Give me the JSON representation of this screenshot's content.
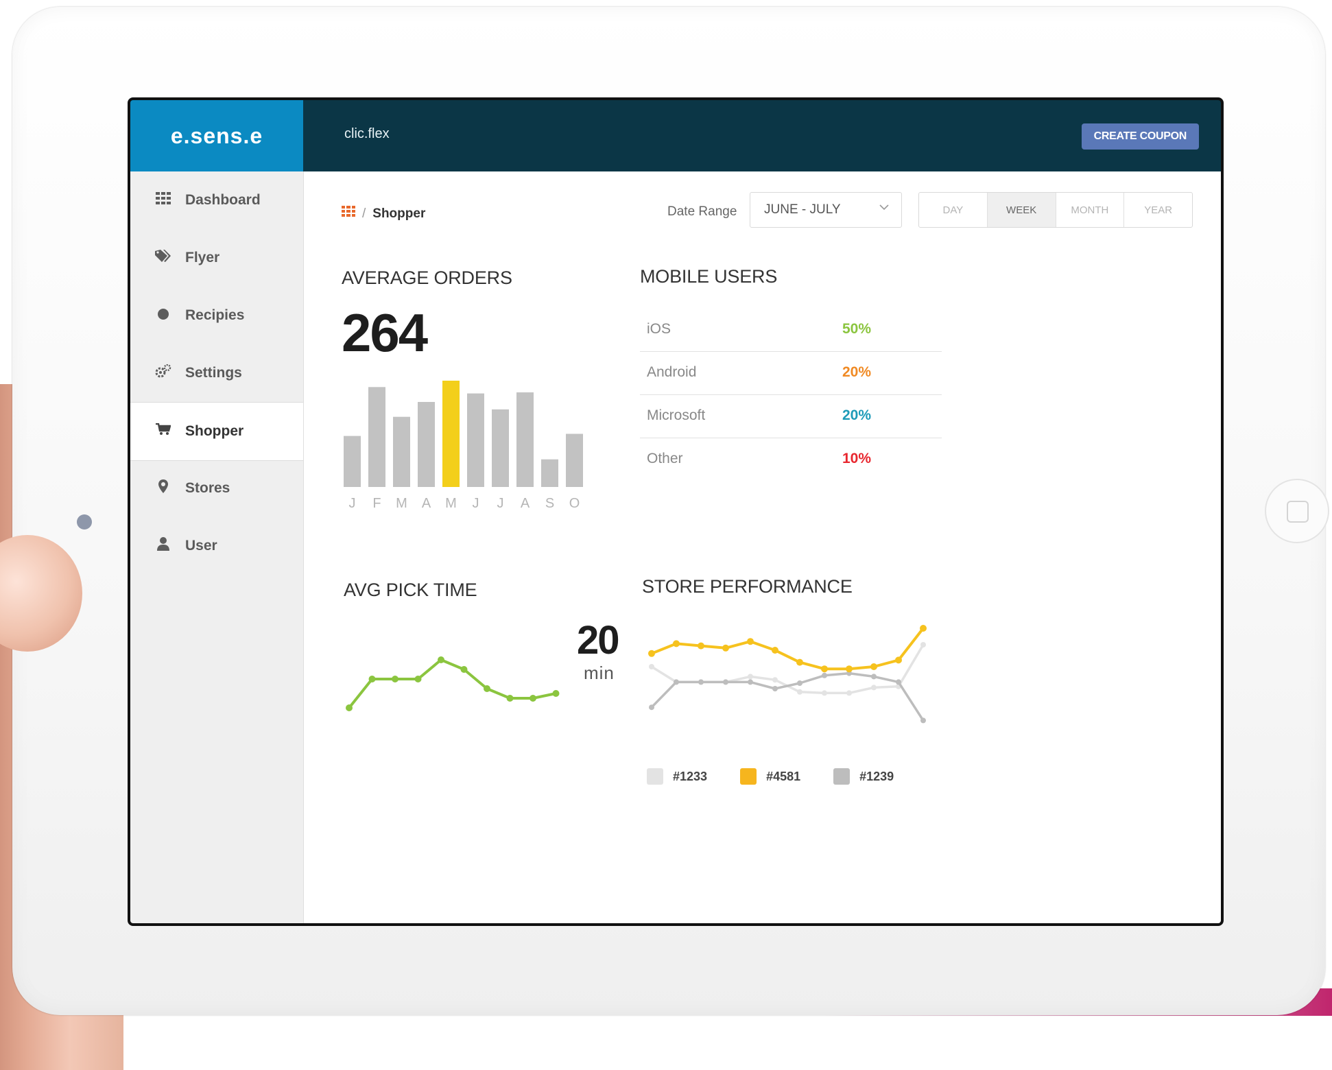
{
  "brand": "e.sens.e",
  "app_title": "clic.flex",
  "create_button": "CREATE COUPON",
  "sidebar": {
    "items": [
      {
        "label": "Dashboard",
        "icon": "grid-icon"
      },
      {
        "label": "Flyer",
        "icon": "tags-icon"
      },
      {
        "label": "Recipies",
        "icon": "circle-icon"
      },
      {
        "label": "Settings",
        "icon": "gears-icon"
      },
      {
        "label": "Shopper",
        "icon": "cart-icon",
        "active": true
      },
      {
        "label": "Stores",
        "icon": "map-marker-icon"
      },
      {
        "label": "User",
        "icon": "user-icon"
      }
    ]
  },
  "breadcrumb": {
    "separator": "/",
    "current": "Shopper"
  },
  "date_range": {
    "label": "Date Range",
    "value": "JUNE - JULY"
  },
  "period_tabs": [
    "DAY",
    "WEEK",
    "MONTH",
    "YEAR"
  ],
  "period_selected": "WEEK",
  "average_orders": {
    "title": "AVERAGE ORDERS",
    "value": "264"
  },
  "mobile_users": {
    "title": "MOBILE USERS",
    "rows": [
      {
        "name": "iOS",
        "value": "50%",
        "color": "#8bc53f"
      },
      {
        "name": "Android",
        "value": "20%",
        "color": "#f08a24"
      },
      {
        "name": "Microsoft",
        "value": "20%",
        "color": "#1e9bb8"
      },
      {
        "name": "Other",
        "value": "10%",
        "color": "#e8262e"
      }
    ]
  },
  "avg_pick_time": {
    "title": "AVG PICK TIME",
    "value": "20",
    "unit": "min"
  },
  "store_performance": {
    "title": "STORE PERFORMANCE",
    "legend": [
      {
        "label": "#1233",
        "color": "#e3e3e3"
      },
      {
        "label": "#4581",
        "color": "#f6b51e"
      },
      {
        "label": "#1239",
        "color": "#bdbdbd"
      }
    ]
  },
  "chart_data": [
    {
      "type": "bar",
      "categories": [
        "J",
        "F",
        "M",
        "A",
        "M",
        "J",
        "J",
        "A",
        "S",
        "O"
      ],
      "values": [
        48,
        94,
        66,
        80,
        100,
        88,
        73,
        89,
        26,
        50
      ],
      "highlight_index": 4,
      "bar_color": "#c2c2c2",
      "highlight_color": "#f3cf1b"
    },
    {
      "type": "line",
      "series": [
        {
          "values": [
            2,
            5,
            5,
            5,
            7,
            6,
            4,
            3,
            3,
            3.5
          ],
          "color": "#8bc53f"
        }
      ]
    },
    {
      "type": "line",
      "x": [
        1,
        2,
        3,
        4,
        5,
        6,
        7,
        8,
        9,
        10,
        11,
        12
      ],
      "series": [
        {
          "name": "#1233",
          "values": [
            6.0,
            4.6,
            4.6,
            4.6,
            5.1,
            4.8,
            3.7,
            3.6,
            3.6,
            4.1,
            4.2,
            8.0
          ],
          "color": "#e3e3e3"
        },
        {
          "name": "#4581",
          "values": [
            7.2,
            8.1,
            7.9,
            7.7,
            8.3,
            7.5,
            6.4,
            5.8,
            5.8,
            6.0,
            6.6,
            9.5
          ],
          "color": "#f6c21e"
        },
        {
          "name": "#1239",
          "values": [
            2.3,
            4.6,
            4.6,
            4.6,
            4.6,
            4.0,
            4.5,
            5.2,
            5.4,
            5.1,
            4.6,
            1.1
          ],
          "color": "#bdbdbd"
        }
      ]
    }
  ]
}
